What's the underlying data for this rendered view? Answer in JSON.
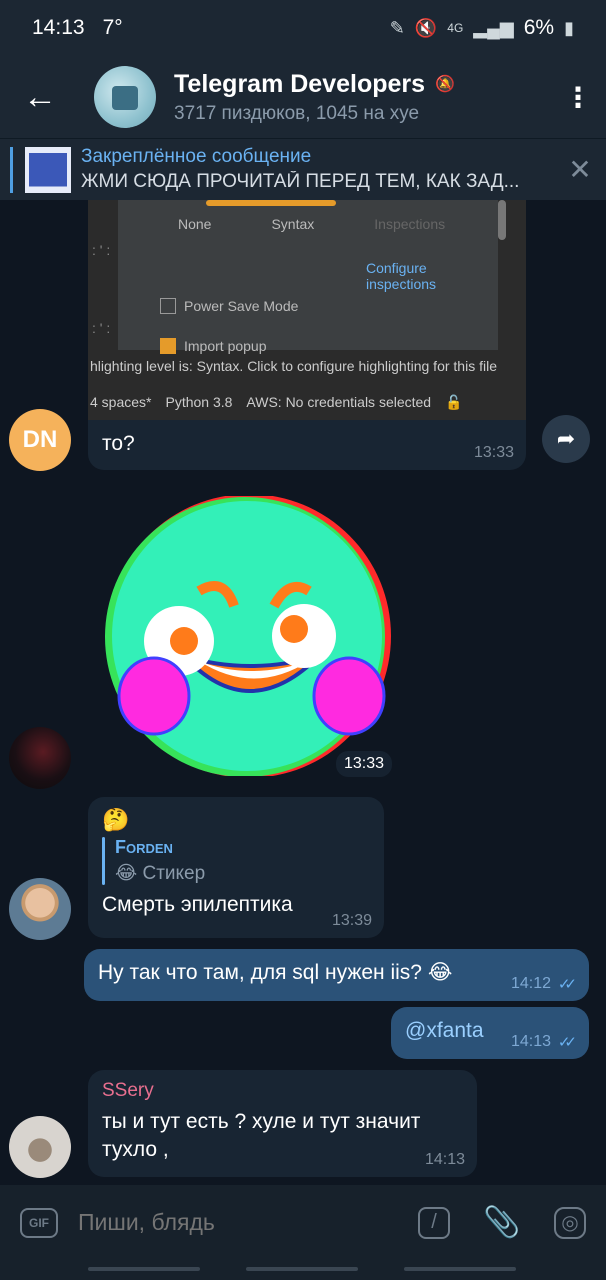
{
  "status": {
    "time": "14:13",
    "temp": "7°",
    "network": "4G",
    "battery": "6%"
  },
  "header": {
    "title": "Telegram Developers",
    "subtitle": "3717 пиздюков, 1045 на хуе"
  },
  "pinned": {
    "title": "Закреплённое сообщение",
    "text": "ЖМИ СЮДА ПРОЧИТАЙ ПЕРЕД ТЕМ, КАК ЗАД..."
  },
  "ide": {
    "opt1": "None",
    "opt2": "Syntax",
    "opt3": "Inspections",
    "configure": "Configure inspections",
    "power_save": "Power Save Mode",
    "import_popup": "Import popup",
    "status": "hlighting level is: Syntax. Click to configure highlighting for this file",
    "spaces": "4 spaces*",
    "python": "Python 3.8",
    "aws": "AWS: No credentials selected"
  },
  "messages": {
    "m1": {
      "avatar": "DN",
      "text": "то?",
      "time": "13:33"
    },
    "m2": {
      "time": "13:33"
    },
    "m3": {
      "emoji": "🤔",
      "reply_name": "Forden",
      "reply_text": "😂 Стикер",
      "text": "Смерть эпилептика",
      "time": "13:39"
    },
    "m4": {
      "text": "Ну так что там, для sql нужен iis? 😂",
      "time": "14:12"
    },
    "m5": {
      "text": "@xfanta",
      "time": "14:13"
    },
    "m6": {
      "sender": "SSery",
      "text": "ты и тут есть ?  хуле и тут значит тухло ,",
      "time": "14:13"
    }
  },
  "input": {
    "gif": "GIF",
    "placeholder": "Пиши, блядь"
  }
}
